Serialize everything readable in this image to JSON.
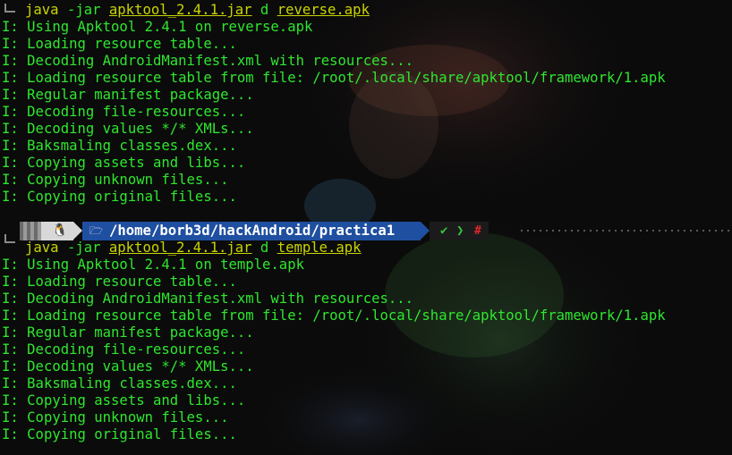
{
  "session1": {
    "command": {
      "program": "java",
      "flag": " -jar ",
      "jar": "apktool_2.4.1.jar",
      "mode": " d ",
      "file": "reverse.apk"
    },
    "lines": [
      "I: Using Apktool 2.4.1 on reverse.apk",
      "I: Loading resource table...",
      "I: Decoding AndroidManifest.xml with resources...",
      "I: Loading resource table from file: /root/.local/share/apktool/framework/1.apk",
      "I: Regular manifest package...",
      "I: Decoding file-resources...",
      "I: Decoding values */* XMLs...",
      "I: Baksmaling classes.dex...",
      "I: Copying assets and libs...",
      "I: Copying unknown files...",
      "I: Copying original files..."
    ]
  },
  "prompt": {
    "os_icon": "linux-tux-icon",
    "folder_icon": "folder-icon",
    "path": "/home/borb3d/hackAndroid/practica1",
    "status_ok": "✔",
    "separator": "❯",
    "root_marker": "#"
  },
  "session2": {
    "command": {
      "program": "java",
      "flag": " -jar ",
      "jar": "apktool_2.4.1.jar",
      "mode": " d ",
      "file": "temple.apk"
    },
    "lines": [
      "I: Using Apktool 2.4.1 on temple.apk",
      "I: Loading resource table...",
      "I: Decoding AndroidManifest.xml with resources...",
      "I: Loading resource table from file: /root/.local/share/apktool/framework/1.apk",
      "I: Regular manifest package...",
      "I: Decoding file-resources...",
      "I: Decoding values */* XMLs...",
      "I: Baksmaling classes.dex...",
      "I: Copying assets and libs...",
      "I: Copying unknown files...",
      "I: Copying original files..."
    ]
  },
  "colors": {
    "output_text": "#2fe62f",
    "command_text": "#c9d400",
    "path_segment": "#1f4fa0",
    "ok": "#36c43a",
    "root": "#e0262b"
  }
}
